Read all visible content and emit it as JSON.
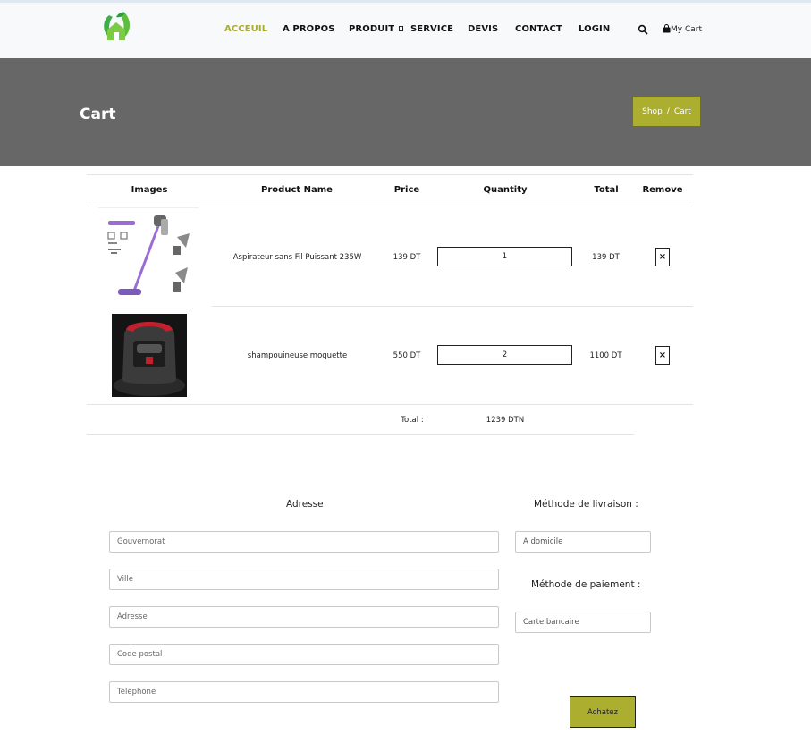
{
  "nav": {
    "items": [
      {
        "label": "ACCEUIL",
        "active": true
      },
      {
        "label": "A PROPOS"
      },
      {
        "label": "PRODUIT"
      },
      {
        "label": "SERVICE"
      },
      {
        "label": "DEVIS"
      },
      {
        "label": "CONTACT"
      },
      {
        "label": "LOGIN"
      }
    ],
    "cart_label": "My Cart",
    "icons": [
      "search-icon",
      "shopping-bag-icon",
      "dropdown-icon"
    ]
  },
  "banner": {
    "title": "Cart",
    "breadcrumb": {
      "shop": "Shop",
      "separator": "/",
      "current": "Cart"
    }
  },
  "table": {
    "headers": [
      "Images",
      "Product Name",
      "Price",
      "Quantity",
      "Total",
      "Remove"
    ],
    "rows": [
      {
        "name": "Aspirateur sans Fil Puissant 235W",
        "price": "139 DT",
        "quantity": "1",
        "total": "139 DT",
        "remove": "×"
      },
      {
        "name": "shampouineuse moquette",
        "price": "550 DT",
        "quantity": "2",
        "total": "1100 DT",
        "remove": "×"
      }
    ],
    "total_label": "Total :",
    "total_value": "1239 DTN"
  },
  "address": {
    "title": "Adresse",
    "fields": {
      "gouvernorat": "Gouvernorat",
      "ville": "Ville",
      "adresse": "Adresse",
      "code_postal": "Code postal",
      "telephone": "Téléphone"
    }
  },
  "delivery": {
    "title": "Méthode de livraison :",
    "value": "A domicile"
  },
  "payment": {
    "title": "Méthode de paiement :",
    "value": "Carte bancaire"
  },
  "checkout": {
    "label": "Achatez"
  },
  "colors": {
    "accent": "#abae2f",
    "banner": "#676767",
    "header": "#f8f9fa"
  }
}
